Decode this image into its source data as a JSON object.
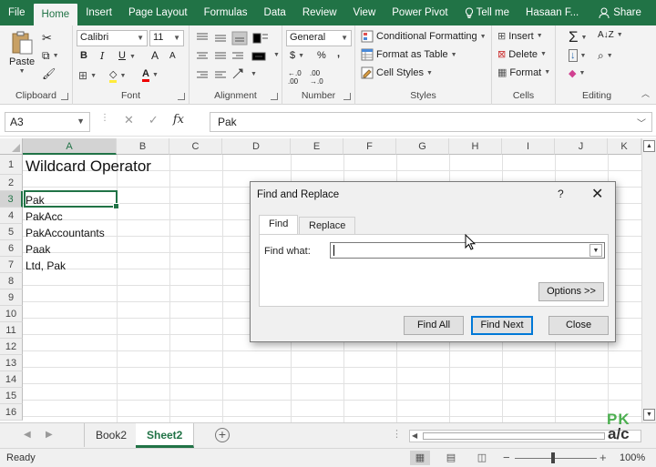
{
  "tabs": [
    "File",
    "Home",
    "Insert",
    "Page Layout",
    "Formulas",
    "Data",
    "Review",
    "View",
    "Power Pivot"
  ],
  "active_tab": "Home",
  "tell_me": "Tell me",
  "user": "Hasaan F...",
  "share": "Share",
  "ribbon": {
    "paste": "Paste",
    "clipboard": "Clipboard",
    "font_name": "Calibri",
    "font_size": "11",
    "font": "Font",
    "bold": "B",
    "italic": "I",
    "underline": "U",
    "grow_font": "A",
    "shrink_font": "A",
    "alignment": "Alignment",
    "number_format": "General",
    "currency": "$",
    "percent": "%",
    "comma": ",",
    "number": "Number",
    "conditional_formatting": "Conditional Formatting",
    "format_as_table": "Format as Table",
    "cell_styles": "Cell Styles",
    "styles": "Styles",
    "insert": "Insert",
    "delete": "Delete",
    "format": "Format",
    "cells": "Cells",
    "editing": "Editing"
  },
  "name_box": "A3",
  "formula_value": "Pak",
  "columns": [
    "A",
    "B",
    "C",
    "D",
    "E",
    "F",
    "G",
    "H",
    "I",
    "J",
    "K"
  ],
  "selected_column": "A",
  "rows": [
    "1",
    "2",
    "3",
    "4",
    "5",
    "6",
    "7",
    "8",
    "9",
    "10",
    "11",
    "12",
    "13",
    "14",
    "15",
    "16"
  ],
  "selected_row": "3",
  "cells": {
    "a1": "Wildcard Operator",
    "a3": "Pak",
    "a4": "PakAcc",
    "a5": "PakAccountants",
    "a6": "Paak",
    "a7": "Ltd, Pak"
  },
  "sheets": [
    "Book2",
    "Sheet2"
  ],
  "active_sheet": "Sheet2",
  "status": "Ready",
  "zoom": "100%",
  "dialog": {
    "title": "Find and Replace",
    "help": "?",
    "close": "✕",
    "tab_find": "Find",
    "tab_replace": "Replace",
    "find_what_label": "Find what:",
    "find_what_value": "",
    "options": "Options >>",
    "find_all": "Find All",
    "find_next": "Find Next",
    "close_btn": "Close"
  },
  "watermark": {
    "top": "PK",
    "bottom": "a/c"
  },
  "colors": {
    "excel_green": "#217346",
    "accent_blue": "#0078d7"
  }
}
